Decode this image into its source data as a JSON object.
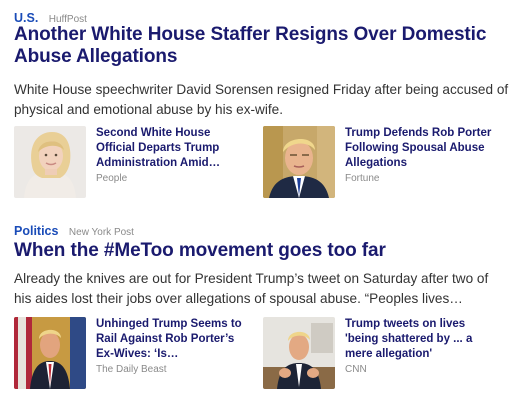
{
  "stories": [
    {
      "category": "U.S.",
      "source": "HuffPost",
      "headline": "Another White House Staffer Resigns Over Domestic Abuse Allegations",
      "summary": "White House speechwriter David Sorensen resigned Friday after being accused of physical and emotional abuse by his ex-wife.",
      "related": [
        {
          "title": "Second White House Official Departs Trump Administration Amid…",
          "source": "People",
          "thumb_icon": "woman-portrait-photo"
        },
        {
          "title": "Trump Defends Rob Porter Following Spousal Abuse Allegations",
          "source": "Fortune",
          "thumb_icon": "man-portrait-photo"
        }
      ]
    },
    {
      "category": "Politics",
      "source": "New York Post",
      "headline": "When the #MeToo movement goes too far",
      "summary": "Already the knives are out for President Trump’s tweet on Saturday after two of his aides lost their jobs over allegations of spousal abuse. “Peoples lives…",
      "related": [
        {
          "title": "Unhinged Trump Seems to Rail Against Rob Porter’s Ex-Wives: ‘Is…",
          "source": "The Daily Beast",
          "thumb_icon": "man-standing-photo"
        },
        {
          "title": "Trump tweets on lives 'being shattered by ... a mere allegation'",
          "source": "CNN",
          "thumb_icon": "man-gesturing-photo"
        }
      ]
    }
  ],
  "colors": {
    "category": "#1a4cb8",
    "headline": "#1a1a6e",
    "source": "#8a8a8a",
    "summary": "#333333"
  }
}
